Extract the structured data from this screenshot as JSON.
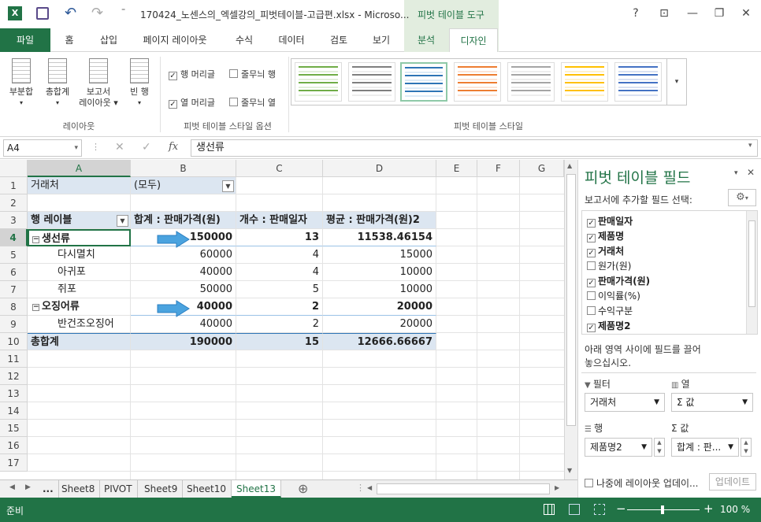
{
  "window": {
    "title": "170424_노센스의_엑셀강의_피벗테이블-고급편.xlsx - Microso...",
    "context_tab_group": "피벗 테이블 도구",
    "help": "?",
    "ribbon_display": "⊡",
    "minimize": "—",
    "restore": "❐",
    "close": "✕"
  },
  "ribbon": {
    "tabs": [
      "파일",
      "홈",
      "삽입",
      "페이지 레이아웃",
      "수식",
      "데이터",
      "검토",
      "보기",
      "분석",
      "디자인"
    ],
    "active_tab": "디자인",
    "layout_group": {
      "label": "레이아웃",
      "buttons": [
        {
          "line1": "부분합",
          "line2": "▾"
        },
        {
          "line1": "총합계",
          "line2": "▾"
        },
        {
          "line1": "보고서",
          "line2": "레이아웃 ▾"
        },
        {
          "line1": "빈 행",
          "line2": "▾"
        }
      ]
    },
    "style_options_group": {
      "label": "피벗 테이블 스타일 옵션",
      "row_headers": "행 머리글",
      "banded_rows": "줄무늬 행",
      "col_headers": "열 머리글",
      "banded_cols": "줄무늬 열",
      "row_headers_checked": true,
      "col_headers_checked": true,
      "banded_rows_checked": false,
      "banded_cols_checked": false
    },
    "styles_group": {
      "label": "피벗 테이블 스타일",
      "swatch_colors": [
        "#70ad47",
        "#7f7f7f",
        "#2e75b6",
        "#ed7d31",
        "#a5a5a5",
        "#ffc000",
        "#4472c4"
      ]
    }
  },
  "formula_bar": {
    "name_box": "A4",
    "name_box_caret": "▾",
    "cancel": "✕",
    "confirm": "✓",
    "fx": "fx",
    "content": "생선류"
  },
  "grid": {
    "columns": [
      "A",
      "B",
      "C",
      "D",
      "E",
      "F",
      "G"
    ],
    "rows": [
      "1",
      "2",
      "3",
      "4",
      "5",
      "6",
      "7",
      "8",
      "9",
      "10",
      "11",
      "12",
      "13",
      "14",
      "15",
      "16",
      "17"
    ],
    "selected_col": "A",
    "selected_row": "4",
    "filter": {
      "label": "거래처",
      "value": "(모두)"
    },
    "header": {
      "row_label": "행 레이블",
      "sum_price": "합계 : 판매가격(원)",
      "count_date": "개수 : 판매일자",
      "avg_price": "평균 : 판매가격(원)2"
    },
    "body": [
      {
        "label": "생선류",
        "b": "150000",
        "c": "13",
        "d": "11538.46154",
        "group": true
      },
      {
        "label": "다시멸치",
        "b": "60000",
        "c": "4",
        "d": "15000",
        "group": false
      },
      {
        "label": "아귀포",
        "b": "40000",
        "c": "4",
        "d": "10000",
        "group": false
      },
      {
        "label": "쥐포",
        "b": "50000",
        "c": "5",
        "d": "10000",
        "group": false
      },
      {
        "label": "오징어류",
        "b": "40000",
        "c": "2",
        "d": "20000",
        "group": true
      },
      {
        "label": "반건조오징어",
        "b": "40000",
        "c": "2",
        "d": "20000",
        "group": false
      }
    ],
    "total": {
      "label": "총합계",
      "b": "190000",
      "c": "15",
      "d": "12666.66667"
    },
    "collapse_glyph": "⊟",
    "arrow_color": "#4aa3df"
  },
  "sheets": {
    "ellipsis": "...",
    "tabs": [
      "Sheet8",
      "PIVOT",
      "Sheet9",
      "Sheet10",
      "Sheet13"
    ],
    "active": "Sheet13",
    "add": "⊕"
  },
  "status": {
    "ready": "준비",
    "zoom": "100 %",
    "zoom_minus": "−",
    "zoom_plus": "+"
  },
  "pivot_pane": {
    "title": "피벗 테이블 필드",
    "subtitle": "보고서에 추가할 필드 선택:",
    "fields": [
      {
        "name": "판매일자",
        "checked": true
      },
      {
        "name": "제품명",
        "checked": true
      },
      {
        "name": "거래처",
        "checked": true
      },
      {
        "name": "원가(원)",
        "checked": false
      },
      {
        "name": "판매가격(원)",
        "checked": true
      },
      {
        "name": "이익률(%)",
        "checked": false
      },
      {
        "name": "수익구분",
        "checked": false
      },
      {
        "name": "제품명2",
        "checked": true
      }
    ],
    "drag_hint_1": "아래 영역 사이에 필드를 끌어",
    "drag_hint_2": "놓으십시오.",
    "areas": {
      "filter_label": "필터",
      "columns_label": "열",
      "rows_label": "행",
      "values_label": "Σ 값",
      "filter_value": "거래처",
      "columns_value": "Σ 값",
      "rows_value": "제품명2",
      "values_value": "합계 : 판..."
    },
    "defer_label": "나중에 레이아웃 업데이...",
    "update_button": "업데이트",
    "settings_icon": "⚙"
  }
}
